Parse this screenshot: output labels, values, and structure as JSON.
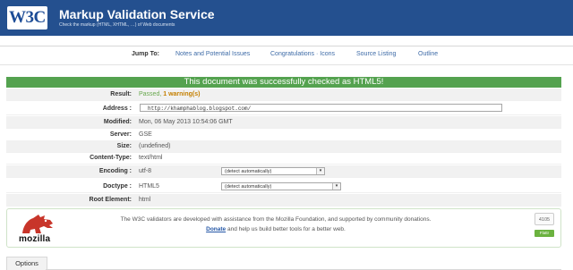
{
  "header": {
    "logo": "W3C",
    "title": "Markup Validation Service",
    "subtitle": "Check the markup (HTML, XHTML, …) of Web documents"
  },
  "nav": {
    "jump_label": "Jump To:",
    "links": [
      "Notes and Potential Issues",
      "Congratulations · Icons",
      "Source Listing",
      "Outline"
    ]
  },
  "result": {
    "banner": "This document was successfully checked as HTML5!",
    "rows": {
      "result_label": "Result:",
      "result_passed": "Passed,",
      "result_warning": "1 warning(s)",
      "address_label": "Address :",
      "address_value": "http://khamphablog.blogspot.com/",
      "modified_label": "Modified:",
      "modified_value": "Mon, 06 May 2013 10:54:06 GMT",
      "server_label": "Server:",
      "server_value": "GSE",
      "size_label": "Size:",
      "size_value": "(undefined)",
      "content_type_label": "Content-Type:",
      "content_type_value": "text/html",
      "encoding_label": "Encoding :",
      "encoding_value": "utf-8",
      "encoding_select": "(detect automatically)",
      "doctype_label": "Doctype :",
      "doctype_value": "HTML5",
      "doctype_select": "(detect automatically)",
      "root_label": "Root Element:",
      "root_value": "html"
    }
  },
  "sponsor": {
    "text1": "The W3C validators are developed with assistance from the Mozilla Foundation, and supported by community donations.",
    "donate": "Donate",
    "text2": " and help us build better tools for a better web.",
    "brand": "mozilla",
    "count": "4105",
    "flattr": "Flattr"
  },
  "options": {
    "label": "Options"
  },
  "colors": {
    "header_bg": "#24508f",
    "banner_bg": "#54a24f",
    "link": "#3e6ba7"
  }
}
